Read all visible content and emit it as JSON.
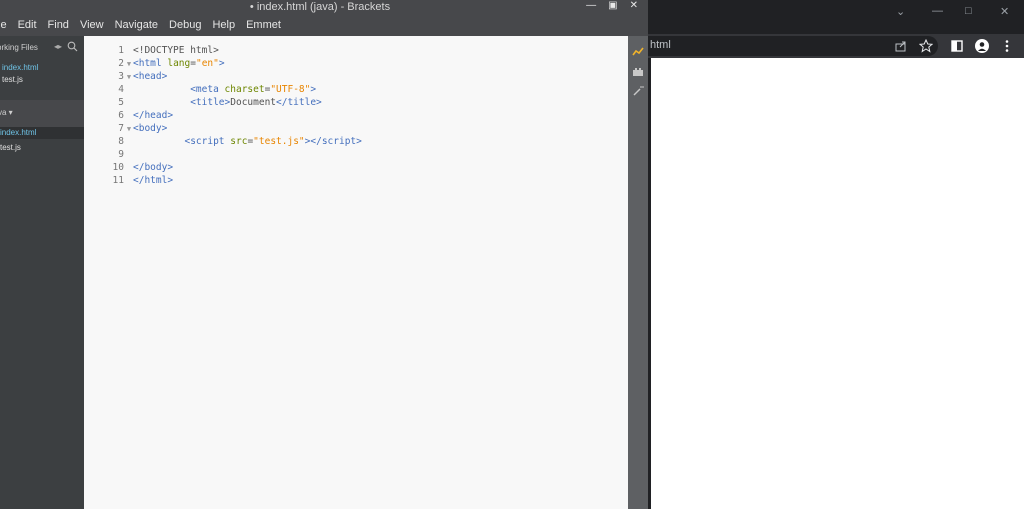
{
  "brackets": {
    "title": "• index.html (java) - Brackets",
    "menu": [
      "le",
      "Edit",
      "Find",
      "View",
      "Navigate",
      "Debug",
      "Help",
      "Emmet"
    ],
    "sidebar": {
      "working_files_label": "orking Files",
      "working_files": [
        {
          "name": "index.html",
          "active": false
        },
        {
          "name": "test.js",
          "active": false
        }
      ],
      "project_label": "va ▾",
      "project_files": [
        {
          "name": "index.html",
          "active": true
        },
        {
          "name": "test.js",
          "active": false
        }
      ]
    },
    "line_numbers": [
      "1",
      "2",
      "3",
      "4",
      "5",
      "6",
      "7",
      "8",
      "9",
      "10",
      "11"
    ]
  },
  "browser": {
    "address_text": "html"
  },
  "colors": {
    "tag": "#446fbd",
    "attr": "#6d8600",
    "value": "#e88501",
    "active_file": "#6fc3e6"
  }
}
